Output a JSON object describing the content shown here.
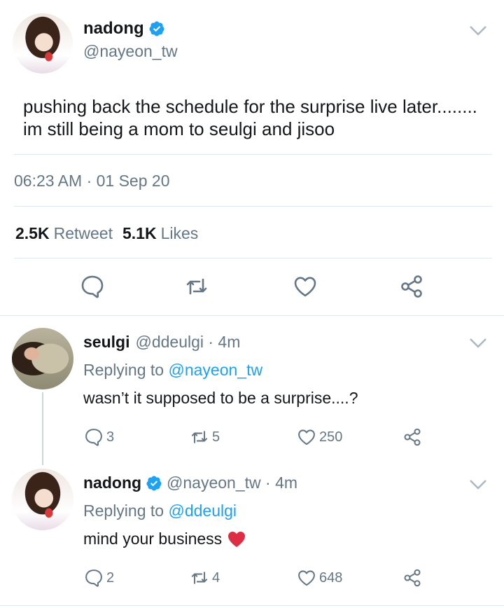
{
  "main_tweet": {
    "name": "nadong",
    "handle": "@nayeon_tw",
    "text": "pushing back the schedule for the surprise live later........ im still being a mom to seulgi and jisoo",
    "timestamp": "06:23 AM · 01 Sep 20",
    "retweets_count": "2.5K",
    "retweets_label": "Retweet",
    "likes_count": "5.1K",
    "likes_label": "Likes",
    "actions": [
      "reply-icon",
      "retweet-icon",
      "like-icon",
      "share-icon"
    ]
  },
  "replies": [
    {
      "name": "seulgi",
      "handle_time": "@ddeulgi · 4m",
      "replying_prefix": "Replying to",
      "replying_to": "@nayeon_tw",
      "text": "wasn’t it supposed to be a surprise....?",
      "reply_count": "3",
      "retweet_count": "5",
      "like_count": "250"
    },
    {
      "name": "nadong",
      "verified": true,
      "handle_time": "@nayeon_tw · 4m",
      "replying_prefix": "Replying to",
      "replying_to": "@ddeulgi",
      "text": "mind your business",
      "emoji": "red-heart",
      "reply_count": "2",
      "retweet_count": "4",
      "like_count": "648"
    }
  ],
  "colors": {
    "accent": "#1da1f2",
    "secondary_text": "#657786",
    "primary_text": "#14171a",
    "divider": "#e1e8ed",
    "heart": "#e0245e"
  }
}
